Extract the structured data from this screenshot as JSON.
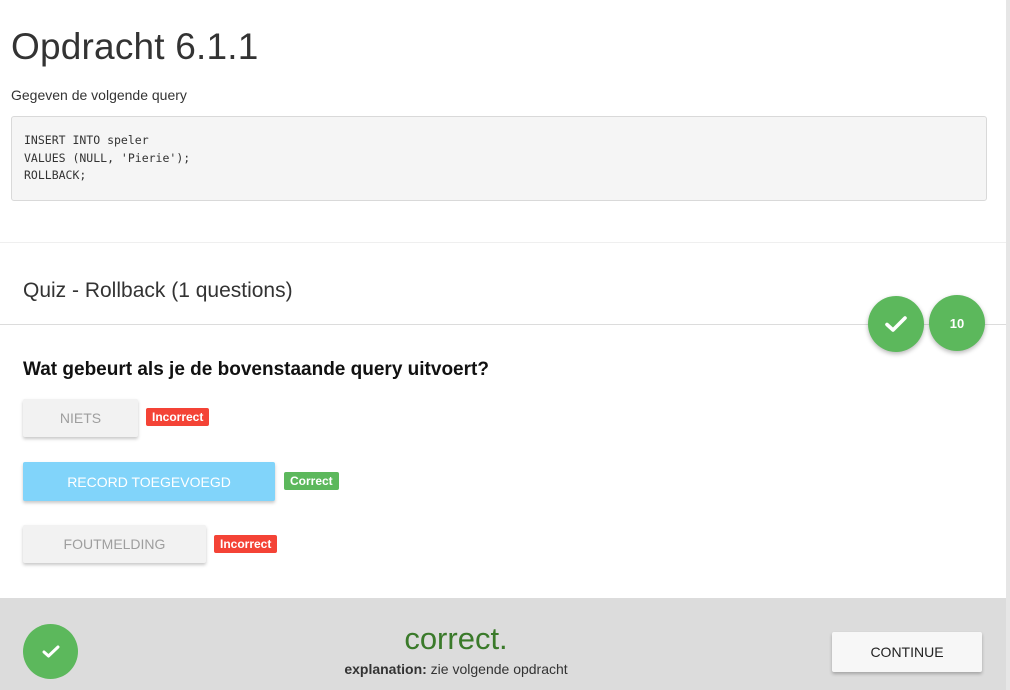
{
  "page": {
    "title": "Opdracht 6.1.1",
    "intro": "Gegeven de volgende query",
    "code": "INSERT INTO speler\nVALUES (NULL, 'Pierie');\nROLLBACK;"
  },
  "quiz": {
    "title": "Quiz - Rollback (1 questions)",
    "score": "10",
    "status_icon": "check-icon",
    "question": "Wat gebeurt als je de bovenstaande query uitvoert?",
    "answers": [
      {
        "label": "NIETS",
        "result": "Incorrect",
        "result_color": "#f44336"
      },
      {
        "label": "RECORD TOEGEVOEGD",
        "result": "Correct",
        "result_color": "#5cb85c"
      },
      {
        "label": "FOUTMELDING",
        "result": "Incorrect",
        "result_color": "#f44336"
      }
    ]
  },
  "footer": {
    "result": "correct.",
    "explanation_label": "explanation:",
    "explanation_text": " zie volgende opdracht",
    "continue_label": "CONTINUE",
    "accent_color": "#5cb85c"
  }
}
